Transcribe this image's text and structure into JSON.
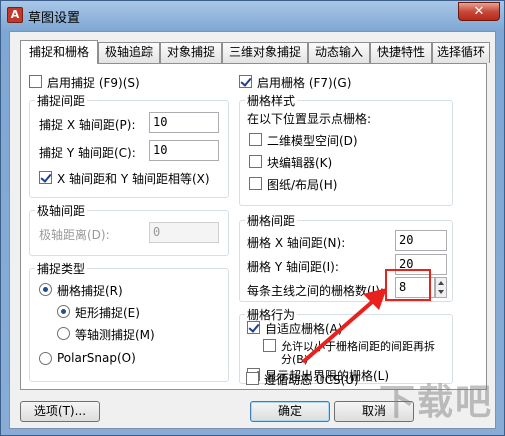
{
  "window": {
    "title": "草图设置",
    "close_glyph": "✕"
  },
  "tabs": [
    {
      "label": "捕捉和栅格"
    },
    {
      "label": "极轴追踪"
    },
    {
      "label": "对象捕捉"
    },
    {
      "label": "三维对象捕捉"
    },
    {
      "label": "动态输入"
    },
    {
      "label": "快捷特性"
    },
    {
      "label": "选择循环"
    }
  ],
  "snap": {
    "enable_label": "启用捕捉 (F9)(S)",
    "enable_checked": false,
    "spacing_group": "捕捉间距",
    "x_label": "捕捉 X 轴间距(P):",
    "x_value": "10",
    "y_label": "捕捉 Y 轴间距(C):",
    "y_value": "10",
    "equal_label": "X 轴间距和 Y 轴间距相等(X)",
    "equal_checked": true,
    "polar_group": "极轴间距",
    "polar_label": "极轴距离(D):",
    "polar_value": "0",
    "type_group": "捕捉类型",
    "grid_snap_label": "栅格捕捉(R)",
    "rect_snap_label": "矩形捕捉(E)",
    "iso_snap_label": "等轴测捕捉(M)",
    "polarsnap_label": "PolarSnap(O)"
  },
  "grid": {
    "enable_label": "启用栅格 (F7)(G)",
    "enable_checked": true,
    "style_group": "栅格样式",
    "style_desc": "在以下位置显示点栅格:",
    "model_label": "二维模型空间(D)",
    "block_label": "块编辑器(K)",
    "sheet_label": "图纸/布局(H)",
    "spacing_group": "栅格间距",
    "x_label": "栅格 X 轴间距(N):",
    "x_value": "20",
    "y_label": "栅格 Y 轴间距(I):",
    "y_value": "20",
    "major_label": "每条主线之间的栅格数(J):",
    "major_value": "8",
    "behavior_group": "栅格行为",
    "adaptive_label": "自适应栅格(A)",
    "adaptive_checked": true,
    "subdivide_label_1": "允许以小于栅格间距的间距再拆",
    "subdivide_label_2": "分(B)",
    "beyond_label": "显示超出界限的栅格(L)",
    "beyond_checked": true,
    "follow_ucs_label": "遵循动态 UCS(U)",
    "follow_ucs_checked": false
  },
  "footer": {
    "options": "选项(T)...",
    "ok": "确定",
    "cancel": "取消"
  },
  "watermark": "下载吧",
  "colors": {
    "highlight": "#e8211d"
  }
}
